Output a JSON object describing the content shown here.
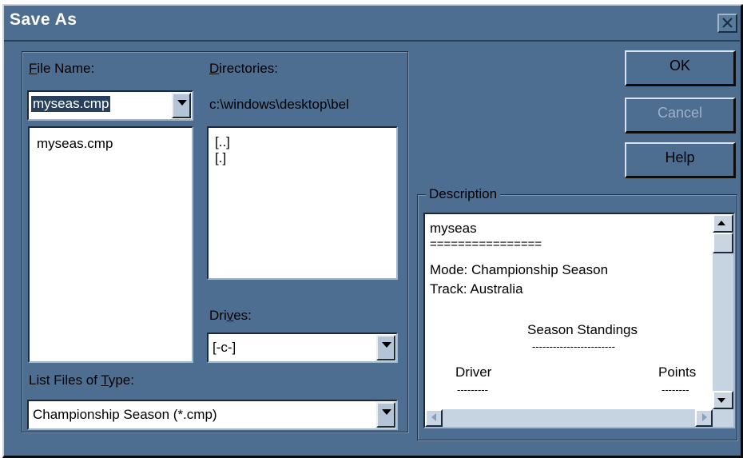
{
  "dialog": {
    "title": "Save As",
    "close_glyph": "✕",
    "close_icon": "close-icon"
  },
  "file_name": {
    "label_prefix": "",
    "label_accel": "F",
    "label_rest": "ile Name:",
    "value": "myseas.cmp",
    "files": [
      "myseas.cmp"
    ]
  },
  "directories": {
    "label_accel": "D",
    "label_rest": "irectories:",
    "path": "c:\\windows\\desktop\\bel",
    "items": [
      "[..]",
      "[.]"
    ]
  },
  "drives": {
    "label_prefix": "Dri",
    "label_accel": "v",
    "label_rest": "es:",
    "value": "[-c-]"
  },
  "file_type": {
    "label_prefix": "List Files of ",
    "label_accel": "T",
    "label_rest": "ype:",
    "value": "Championship Season (*.cmp)"
  },
  "buttons": {
    "ok": "OK",
    "cancel": "Cancel",
    "help": "Help"
  },
  "description": {
    "label": "Description",
    "name": "myseas",
    "separator": "================",
    "mode": "Mode: Championship Season",
    "track": "Track: Australia",
    "standings_title": "Season Standings",
    "standings_rule": "------------------------",
    "col_driver": "Driver",
    "col_points": "Points",
    "driver_rule": "---------",
    "points_rule": "--------"
  },
  "colors": {
    "dialog_face": "#4d6d91",
    "panel": "#ffffff",
    "selection": "#27405b",
    "disabled_text": "#9eb2c7"
  }
}
